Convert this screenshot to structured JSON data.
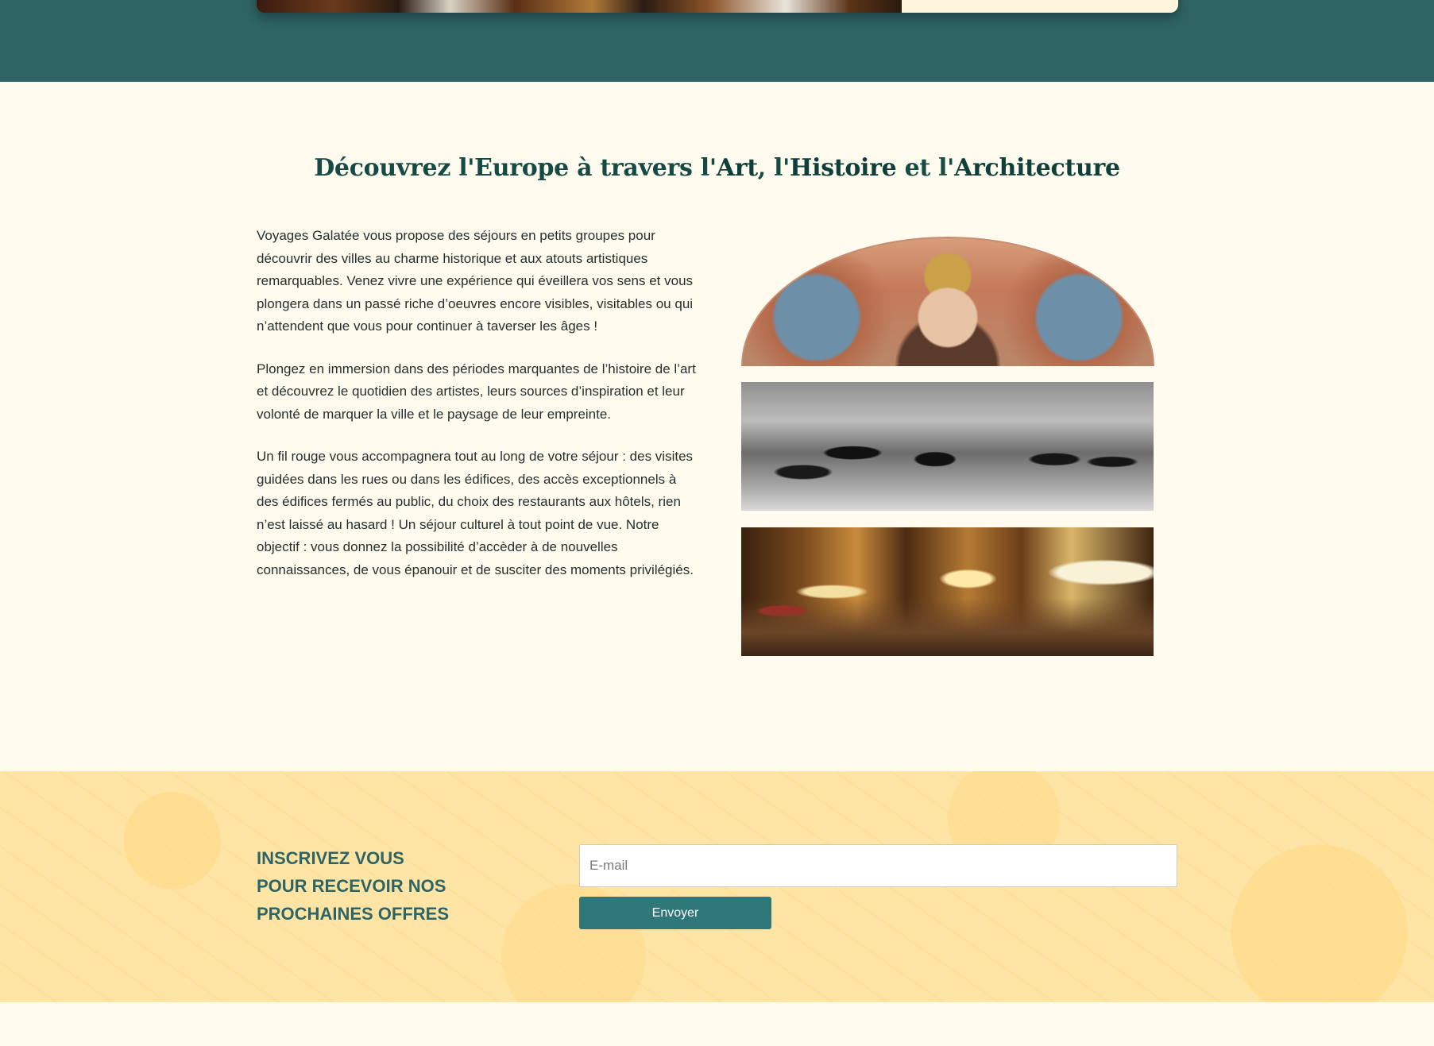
{
  "intro": {
    "title_parts": {
      "p1": "Découvrez l'Europe à travers l'",
      "b1": "Art",
      "p2": ", l'",
      "b2": "Histoire",
      "p3": " et l'",
      "b3": "Architecture"
    },
    "paragraphs": [
      "Voyages Galatée vous propose des séjours en petits groupes pour découvrir des villes au charme historique et aux atouts artistiques remarquables. Venez vivre une expérience qui éveillera vos sens et vous plongera dans un passé riche d’oeuvres encore visibles, visitables ou qui n’attendent que vous pour continuer à taverser les âges !",
      "Plongez en immersion dans des périodes marquantes de l’histoire de l’art et découvrez le quotidien des artistes, leurs sources d’inspiration et leur volonté de marquer la ville et le paysage de leur empreinte.",
      "Un fil rouge vous accompagnera tout au long de votre séjour : des visites guidées dans les rues ou dans les édifices, des accès exceptionnels à des édifices fermés au public, du choix des restaurants aux hôtels, rien n’est laissé au hasard ! Un séjour culturel à tout point de vue. Notre objectif : vous donnez la possibilité d’accèder à de nouvelles connaissances, de vous épanouir et de susciter des moments privilégiés."
    ]
  },
  "newsletter": {
    "title_lines": [
      "INSCRIVEZ VOUS",
      "POUR RECEVOIR NOS",
      "PROCHAINES OFFRES"
    ],
    "email_placeholder": "E-mail",
    "email_value": "",
    "submit_label": "Envoyer"
  },
  "colors": {
    "teal": "#2f6464",
    "cream": "#fffcef",
    "newsletter_bg": "#ffe5a5",
    "button": "#2f7778",
    "title_green": "#164a45"
  }
}
